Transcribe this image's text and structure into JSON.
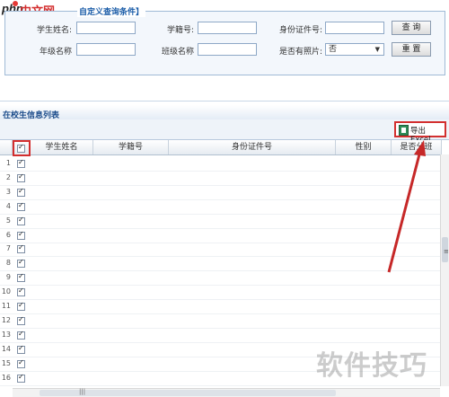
{
  "logo": {
    "part1": "php",
    "part2": "中文网"
  },
  "query": {
    "title": "自定义查询条件】",
    "student_name_label": "学生姓名:",
    "student_no_label": "学籍号:",
    "id_no_label": "身份证件号:",
    "grade_label": "年级名称",
    "class_label": "班级名称",
    "has_photo_label": "是否有照片:",
    "has_photo_value": "否",
    "query_button": "查 询",
    "reset_button": "重 置"
  },
  "list": {
    "title": "在校生信息列表",
    "export_button": "导出Excel",
    "columns": [
      "学生姓名",
      "学籍号",
      "身份证件号",
      "性别",
      "是否分班"
    ],
    "row_numbers": [
      "1",
      "2",
      "3",
      "4",
      "5",
      "6",
      "7",
      "8",
      "9",
      "10",
      "11",
      "12",
      "13",
      "14",
      "15",
      "16"
    ],
    "all_rows_checked": true
  },
  "watermark": "软件技巧",
  "colors": {
    "highlight": "#d32f2f",
    "panel_border": "#9fbad6",
    "title_blue": "#1e4e8c"
  }
}
